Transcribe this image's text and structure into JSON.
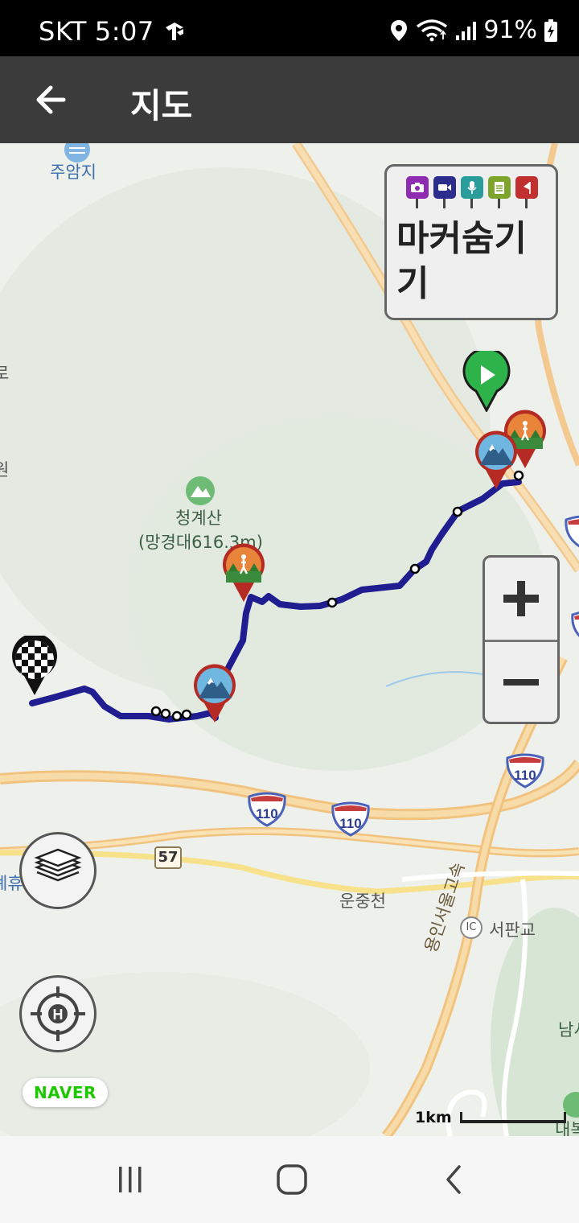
{
  "status_bar": {
    "carrier": "SKT",
    "time": "5:07",
    "battery": "91%",
    "icons": [
      "tmap-icon",
      "location-icon",
      "wifi-icon",
      "signal-icon",
      "battery-charging-icon"
    ]
  },
  "app_bar": {
    "back_icon": "arrow-left-icon",
    "title": "지도"
  },
  "map": {
    "labels": {
      "reservoir": "주암지",
      "mountain_name": "청계산",
      "mountain_sub": "(망경대616.3m)",
      "stream": "운중천",
      "ic_badge": "IC",
      "interchange": "서판교",
      "expressway": "용인서울고속",
      "partial_left_1": "원",
      "partial_left_2": "로",
      "partial_left_3": "계휴",
      "partial_right_1": "남서",
      "partial_right_2": "내복"
    },
    "route_shields": [
      "110",
      "110",
      "110"
    ],
    "road_number": "57",
    "marker_toggle": {
      "label": "마커숨기기",
      "icons": [
        "camera-icon",
        "video-icon",
        "microphone-icon",
        "note-icon",
        "flag-icon"
      ],
      "colors": [
        "#8e2bb0",
        "#2c2d8c",
        "#2a9d9a",
        "#7da52b",
        "#c0302f"
      ]
    },
    "zoom_in": "+",
    "zoom_out": "−",
    "brand": "NAVER",
    "scale_label": "1km",
    "route_color": "#1f1d8f",
    "start_pin_color": "#2db34a",
    "waypoint_pin_color": "#b52a22"
  },
  "nav_bar": {
    "icons": [
      "recent-apps-icon",
      "home-icon",
      "back-icon"
    ]
  }
}
